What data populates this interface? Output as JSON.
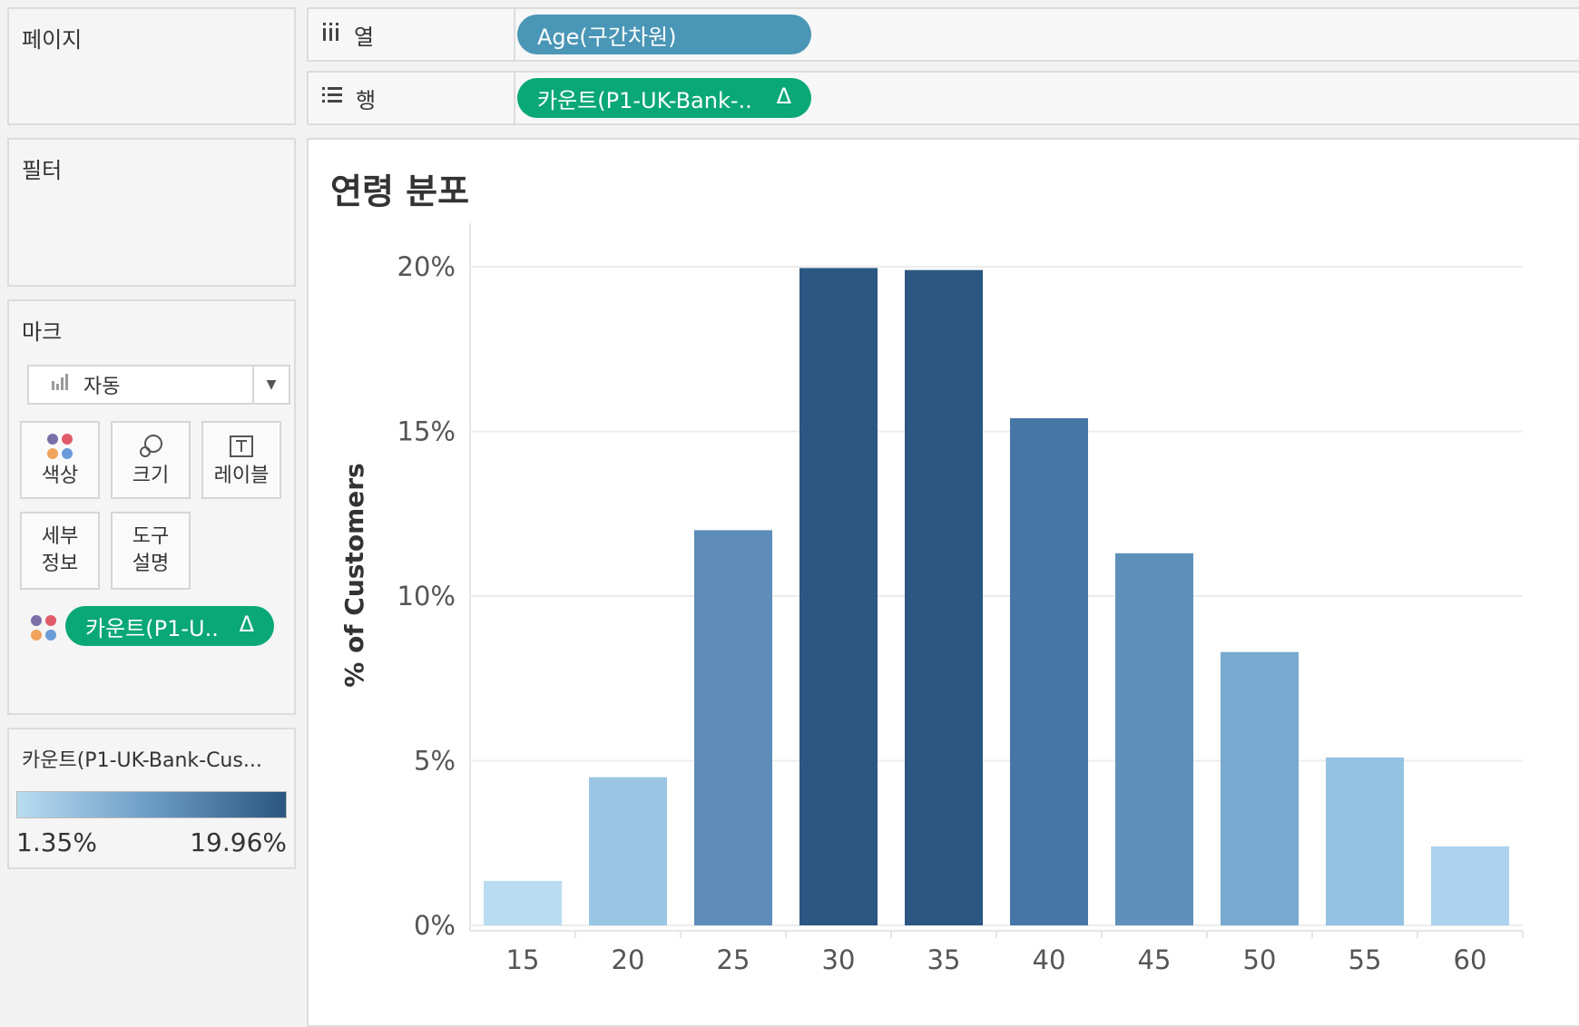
{
  "cards": {
    "pages": {
      "title": "페이지"
    },
    "filters": {
      "title": "필터"
    },
    "marks": {
      "title": "마크",
      "mark_type": "자동",
      "buttons": {
        "color": "색상",
        "size": "크기",
        "label": "레이블",
        "detail_line1": "세부",
        "detail_line2": "정보",
        "tooltip_line1": "도구",
        "tooltip_line2": "설명"
      },
      "color_pill": "카운트(P1-U..",
      "pill_delta": "Δ"
    },
    "legend": {
      "title": "카운트(P1-UK-Bank-Cus...",
      "min": "1.35%",
      "max": "19.96%",
      "color_low": "#b9dcf0",
      "color_high": "#2a5680"
    }
  },
  "shelves": {
    "columns": {
      "label": "열",
      "icon": "columns-icon",
      "pill": "Age(구간차원)"
    },
    "rows": {
      "label": "행",
      "icon": "rows-icon",
      "pill": "카운트(P1-UK-Bank-..",
      "pill_delta": "Δ"
    }
  },
  "view": {
    "title": "연령 분포"
  },
  "chart_data": {
    "type": "bar",
    "categories": [
      "15",
      "20",
      "25",
      "30",
      "35",
      "40",
      "45",
      "50",
      "55",
      "60"
    ],
    "values": [
      1.35,
      4.5,
      12.0,
      19.96,
      19.9,
      15.4,
      11.3,
      8.3,
      5.1,
      2.4
    ],
    "colors": [
      "#b9dcf0",
      "#99c6e4",
      "#5d8db8",
      "#2b5782",
      "#2b5782",
      "#4676a6",
      "#5e90bb",
      "#78a9d0",
      "#94c2e3",
      "#acd2ee"
    ],
    "ylabel": "% of Customers",
    "xlabel": "",
    "ylim": [
      0,
      20
    ],
    "yticks": [
      "0%",
      "5%",
      "10%",
      "15%",
      "20%"
    ],
    "grid": true
  }
}
